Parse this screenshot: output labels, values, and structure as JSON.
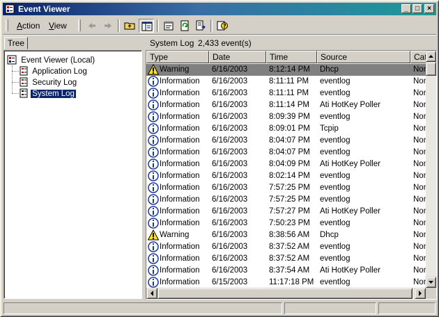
{
  "window": {
    "title": "Event Viewer"
  },
  "menu": {
    "action": "Action",
    "view": "View"
  },
  "left": {
    "tab": "Tree",
    "root": "Event Viewer (Local)",
    "items": [
      "Application Log",
      "Security Log",
      "System Log"
    ],
    "selected": "System Log"
  },
  "right": {
    "header_title": "System Log",
    "header_count": "2,433 event(s)",
    "columns": [
      "Type",
      "Date",
      "Time",
      "Source",
      "Catego"
    ],
    "rows": [
      {
        "type": "Warning",
        "date": "6/16/2003",
        "time": "8:12:14 PM",
        "source": "Dhcp",
        "category": "None"
      },
      {
        "type": "Information",
        "date": "6/16/2003",
        "time": "8:11:11 PM",
        "source": "eventlog",
        "category": "None"
      },
      {
        "type": "Information",
        "date": "6/16/2003",
        "time": "8:11:11 PM",
        "source": "eventlog",
        "category": "None"
      },
      {
        "type": "Information",
        "date": "6/16/2003",
        "time": "8:11:14 PM",
        "source": "Ati HotKey Poller",
        "category": "None"
      },
      {
        "type": "Information",
        "date": "6/16/2003",
        "time": "8:09:39 PM",
        "source": "eventlog",
        "category": "None"
      },
      {
        "type": "Information",
        "date": "6/16/2003",
        "time": "8:09:01 PM",
        "source": "Tcpip",
        "category": "None"
      },
      {
        "type": "Information",
        "date": "6/16/2003",
        "time": "8:04:07 PM",
        "source": "eventlog",
        "category": "None"
      },
      {
        "type": "Information",
        "date": "6/16/2003",
        "time": "8:04:07 PM",
        "source": "eventlog",
        "category": "None"
      },
      {
        "type": "Information",
        "date": "6/16/2003",
        "time": "8:04:09 PM",
        "source": "Ati HotKey Poller",
        "category": "None"
      },
      {
        "type": "Information",
        "date": "6/16/2003",
        "time": "8:02:14 PM",
        "source": "eventlog",
        "category": "None"
      },
      {
        "type": "Information",
        "date": "6/16/2003",
        "time": "7:57:25 PM",
        "source": "eventlog",
        "category": "None"
      },
      {
        "type": "Information",
        "date": "6/16/2003",
        "time": "7:57:25 PM",
        "source": "eventlog",
        "category": "None"
      },
      {
        "type": "Information",
        "date": "6/16/2003",
        "time": "7:57:27 PM",
        "source": "Ati HotKey Poller",
        "category": "None"
      },
      {
        "type": "Information",
        "date": "6/16/2003",
        "time": "7:50:23 PM",
        "source": "eventlog",
        "category": "None"
      },
      {
        "type": "Warning",
        "date": "6/16/2003",
        "time": "8:38:56 AM",
        "source": "Dhcp",
        "category": "None"
      },
      {
        "type": "Information",
        "date": "6/16/2003",
        "time": "8:37:52 AM",
        "source": "eventlog",
        "category": "None"
      },
      {
        "type": "Information",
        "date": "6/16/2003",
        "time": "8:37:52 AM",
        "source": "eventlog",
        "category": "None"
      },
      {
        "type": "Information",
        "date": "6/16/2003",
        "time": "8:37:54 AM",
        "source": "Ati HotKey Poller",
        "category": "None"
      },
      {
        "type": "Information",
        "date": "6/15/2003",
        "time": "11:17:18 PM",
        "source": "eventlog",
        "category": "None"
      }
    ],
    "selected_row": 0
  },
  "icons": {
    "toolbar": [
      "back-arrow-icon",
      "forward-arrow-icon",
      "up-folder-icon",
      "show-hide-tree-icon",
      "properties-icon",
      "refresh-icon",
      "export-list-icon",
      "help-icon"
    ],
    "warning": "warning-icon",
    "information": "information-icon"
  },
  "colors": {
    "selection": "#0a246a",
    "title_start": "#0a246a",
    "title_end": "#1c9a9a",
    "face": "#d4d0c8"
  }
}
